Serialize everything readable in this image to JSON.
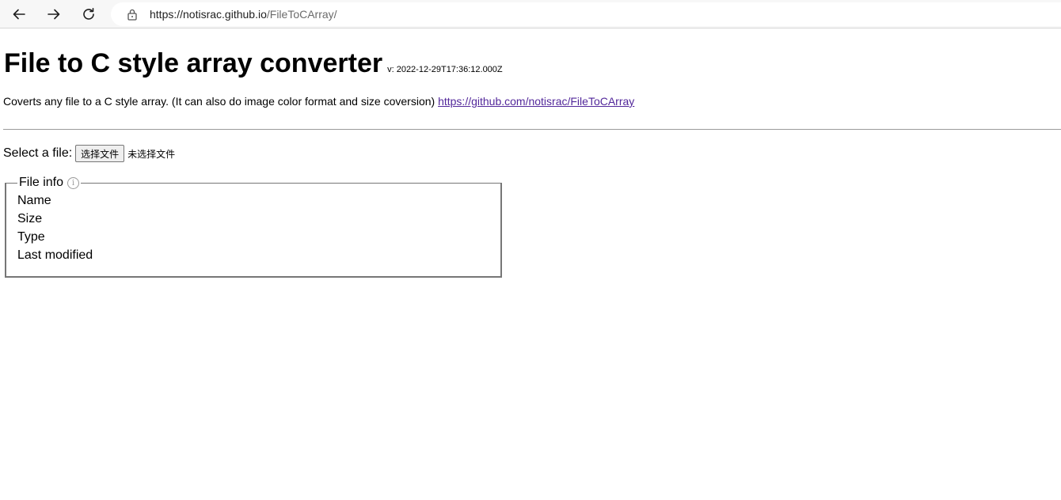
{
  "browser": {
    "url_host": "https://notisrac.github.io",
    "url_path": "/FileToCArray/"
  },
  "page": {
    "title": "File to C style array converter",
    "version": "v: 2022-12-29T17:36:12.000Z",
    "description": "Coverts any file to a C style array. (It can also do image color format and size coversion)",
    "repo_link": "https://github.com/notisrac/FileToCArray"
  },
  "file_select": {
    "label": "Select a file:",
    "button_label": "选择文件",
    "status": "未选择文件"
  },
  "file_info": {
    "legend": "File info",
    "fields": [
      "Name",
      "Size",
      "Type",
      "Last modified"
    ]
  }
}
